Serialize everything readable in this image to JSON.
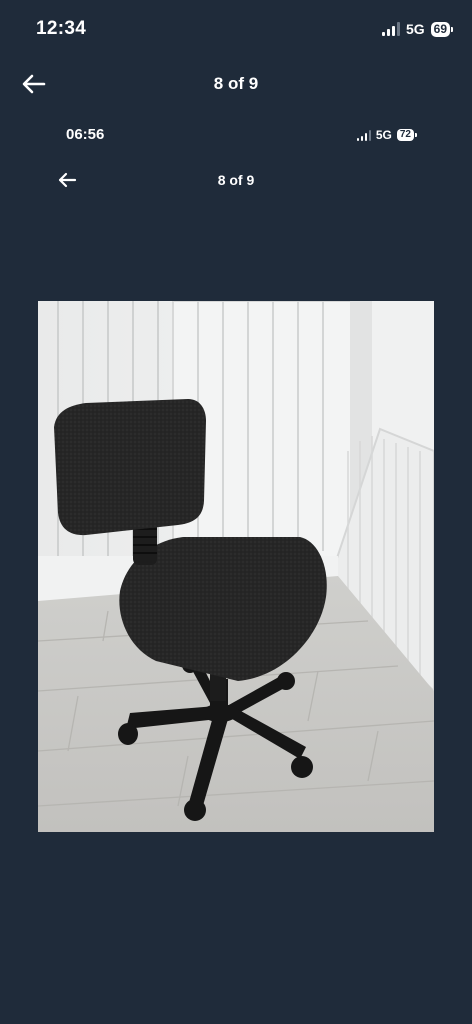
{
  "status_bar": {
    "time": "12:34",
    "network": "5G",
    "battery": "69"
  },
  "nav": {
    "back_icon": "arrow-left-icon",
    "title": "8 of 9"
  },
  "embedded_screenshot": {
    "status_bar": {
      "time": "06:56",
      "network": "5G",
      "battery": "72"
    },
    "nav": {
      "back_icon": "arrow-left-icon",
      "title": "8 of 9"
    }
  },
  "photo": {
    "subject": "black office swivel chair",
    "icon": "photo-image"
  },
  "colors": {
    "background": "#1f2b3a",
    "text": "#ffffff"
  }
}
